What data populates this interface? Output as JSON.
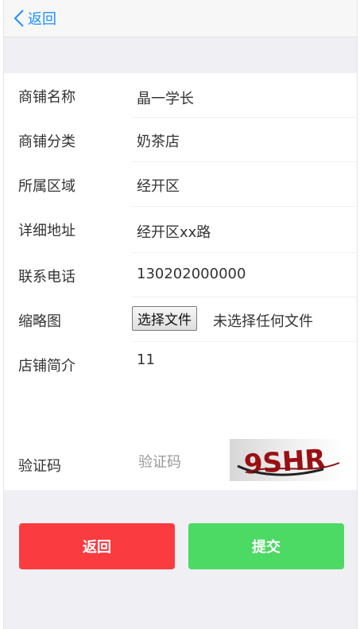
{
  "header": {
    "back_label": "返回"
  },
  "form": {
    "rows": [
      {
        "label": "商铺名称",
        "value": "晶一学长"
      },
      {
        "label": "商铺分类",
        "value": "奶茶店"
      },
      {
        "label": "所属区域",
        "value": "经开区"
      },
      {
        "label": "详细地址",
        "value": "经开区xx路"
      },
      {
        "label": "联系电话",
        "value": "130202000000"
      }
    ],
    "thumbnail": {
      "label": "缩略图",
      "button_label": "选择文件",
      "status": "未选择任何文件"
    },
    "intro": {
      "label": "店铺简介",
      "value": "11"
    },
    "captcha": {
      "label": "验证码",
      "placeholder": "验证码",
      "image_text": "9SHR"
    }
  },
  "actions": {
    "back_label": "返回",
    "submit_label": "提交"
  },
  "colors": {
    "accent": "#1e90ff",
    "back_button": "#fa3c40",
    "submit_button": "#4cd964"
  }
}
